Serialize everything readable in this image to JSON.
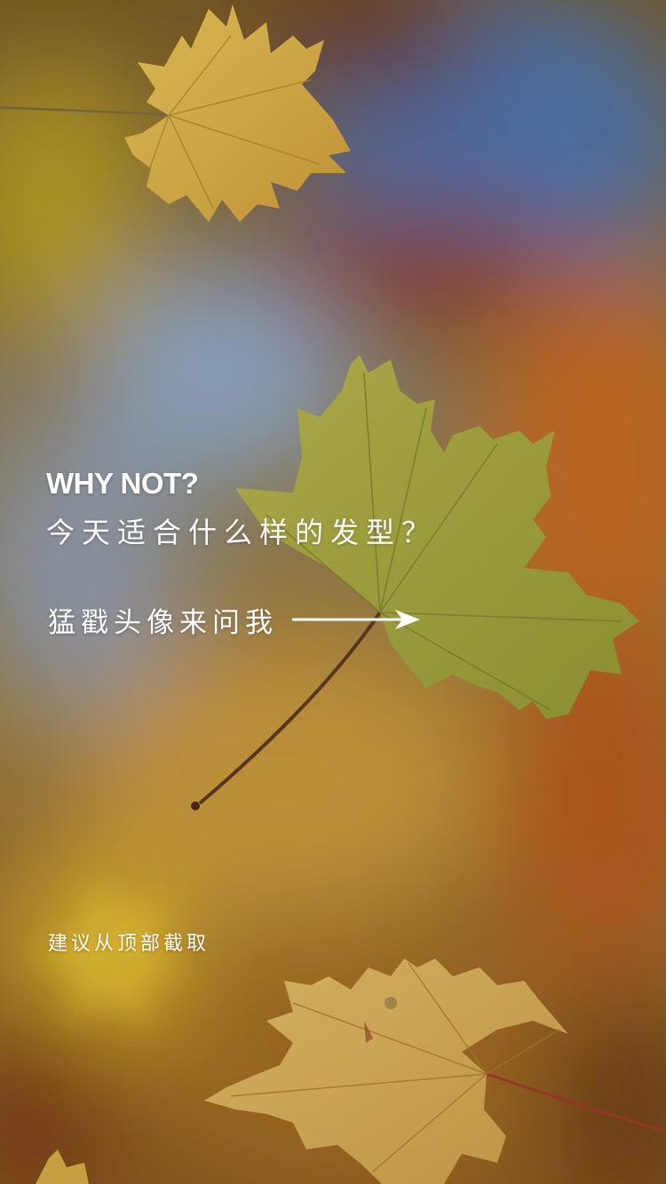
{
  "headline": {
    "en": "WHY NOT?",
    "cn": "今天适合什么样的发型？"
  },
  "cta": {
    "text": "猛戳头像来问我",
    "icon": "arrow-right-icon"
  },
  "hint": {
    "text": "建议从顶部截取"
  },
  "colors": {
    "text": "#ffffff",
    "leaf_yellow": "#d9b54a",
    "leaf_green": "#a3a83a",
    "sky_blue": "#5b7fa6",
    "autumn_orange": "#c07a2c"
  }
}
